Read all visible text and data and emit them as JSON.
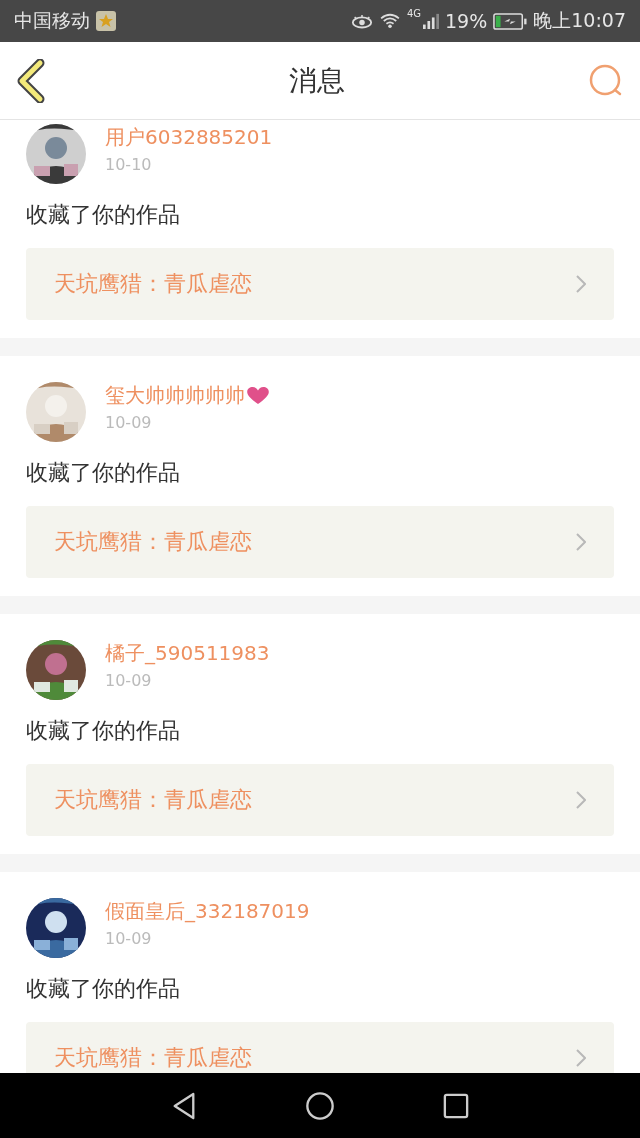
{
  "status_bar": {
    "carrier": "中国移动",
    "network": "4G",
    "battery": "19%",
    "time": "晚上10:07"
  },
  "header": {
    "title": "消息"
  },
  "messages": [
    {
      "user": "用户6032885201",
      "heart": false,
      "date": "10-10",
      "action": "收藏了你的作品",
      "work": "天坑鹰猎：青瓜虐恋"
    },
    {
      "user": "玺大帅帅帅帅帅",
      "heart": true,
      "date": "10-09",
      "action": "收藏了你的作品",
      "work": "天坑鹰猎：青瓜虐恋"
    },
    {
      "user": "橘子_590511983",
      "heart": false,
      "date": "10-09",
      "action": "收藏了你的作品",
      "work": "天坑鹰猎：青瓜虐恋"
    },
    {
      "user": "假面皇后_332187019",
      "heart": false,
      "date": "10-09",
      "action": "收藏了你的作品",
      "work": "天坑鹰猎：青瓜虐恋"
    }
  ]
}
